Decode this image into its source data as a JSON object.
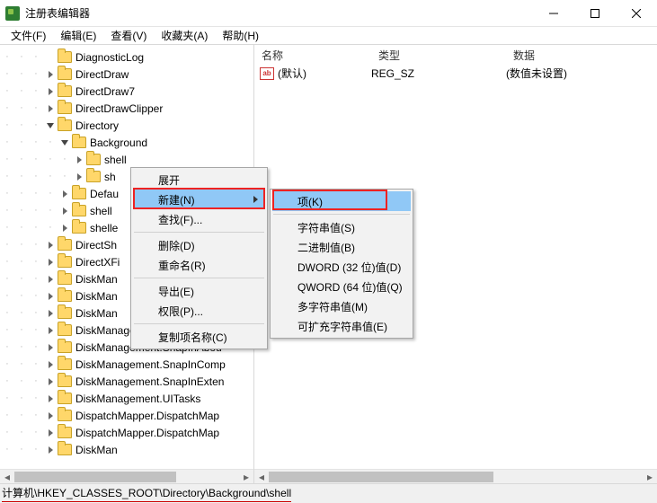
{
  "window": {
    "title": "注册表编辑器"
  },
  "menubar": [
    "文件(F)",
    "编辑(E)",
    "查看(V)",
    "收藏夹(A)",
    "帮助(H)"
  ],
  "list": {
    "headers": {
      "name": "名称",
      "type": "类型",
      "data": "数据"
    },
    "rows": [
      {
        "name": "(默认)",
        "type": "REG_SZ",
        "data": "(数值未设置)"
      }
    ]
  },
  "tree": {
    "items": [
      {
        "indent": 3,
        "tw": "none",
        "label": "DiagnosticLog"
      },
      {
        "indent": 3,
        "tw": "closed",
        "label": "DirectDraw"
      },
      {
        "indent": 3,
        "tw": "closed",
        "label": "DirectDraw7"
      },
      {
        "indent": 3,
        "tw": "closed",
        "label": "DirectDrawClipper"
      },
      {
        "indent": 3,
        "tw": "open",
        "label": "Directory"
      },
      {
        "indent": 4,
        "tw": "open",
        "label": "Background"
      },
      {
        "indent": 5,
        "tw": "closed",
        "label": "shell"
      },
      {
        "indent": 5,
        "tw": "closed",
        "label": "sh"
      },
      {
        "indent": 4,
        "tw": "closed",
        "label": "Defau"
      },
      {
        "indent": 4,
        "tw": "closed",
        "label": "shell"
      },
      {
        "indent": 4,
        "tw": "closed",
        "label": "shelle"
      },
      {
        "indent": 3,
        "tw": "closed",
        "label": "DirectSh"
      },
      {
        "indent": 3,
        "tw": "closed",
        "label": "DirectXFi"
      },
      {
        "indent": 3,
        "tw": "closed",
        "label": "DiskMan"
      },
      {
        "indent": 3,
        "tw": "closed",
        "label": "DiskMan"
      },
      {
        "indent": 3,
        "tw": "closed",
        "label": "DiskMan"
      },
      {
        "indent": 3,
        "tw": "closed",
        "label": "DiskManagement.SnapIn"
      },
      {
        "indent": 3,
        "tw": "closed",
        "label": "DiskManagement.SnapInAbou"
      },
      {
        "indent": 3,
        "tw": "closed",
        "label": "DiskManagement.SnapInComp"
      },
      {
        "indent": 3,
        "tw": "closed",
        "label": "DiskManagement.SnapInExten"
      },
      {
        "indent": 3,
        "tw": "closed",
        "label": "DiskManagement.UITasks"
      },
      {
        "indent": 3,
        "tw": "closed",
        "label": "DispatchMapper.DispatchMap"
      },
      {
        "indent": 3,
        "tw": "closed",
        "label": "DispatchMapper.DispatchMap"
      },
      {
        "indent": 3,
        "tw": "closed",
        "label": "DiskMan"
      }
    ]
  },
  "ctx1": {
    "items": [
      {
        "label": "展开",
        "sub": false
      },
      {
        "label": "新建(N)",
        "sub": true,
        "hover": true
      },
      {
        "label": "查找(F)...",
        "sub": false
      },
      {
        "sep": true
      },
      {
        "label": "删除(D)",
        "sub": false
      },
      {
        "label": "重命名(R)",
        "sub": false
      },
      {
        "sep": true
      },
      {
        "label": "导出(E)",
        "sub": false
      },
      {
        "label": "权限(P)...",
        "sub": false
      },
      {
        "sep": true
      },
      {
        "label": "复制项名称(C)",
        "sub": false
      }
    ]
  },
  "ctx2": {
    "items": [
      {
        "label": "项(K)",
        "hover": true
      },
      {
        "sep": true
      },
      {
        "label": "字符串值(S)"
      },
      {
        "label": "二进制值(B)"
      },
      {
        "label": "DWORD (32 位)值(D)"
      },
      {
        "label": "QWORD (64 位)值(Q)"
      },
      {
        "label": "多字符串值(M)"
      },
      {
        "label": "可扩充字符串值(E)"
      }
    ]
  },
  "status": {
    "path": "计算机\\HKEY_CLASSES_ROOT\\Directory\\Background\\shell"
  }
}
